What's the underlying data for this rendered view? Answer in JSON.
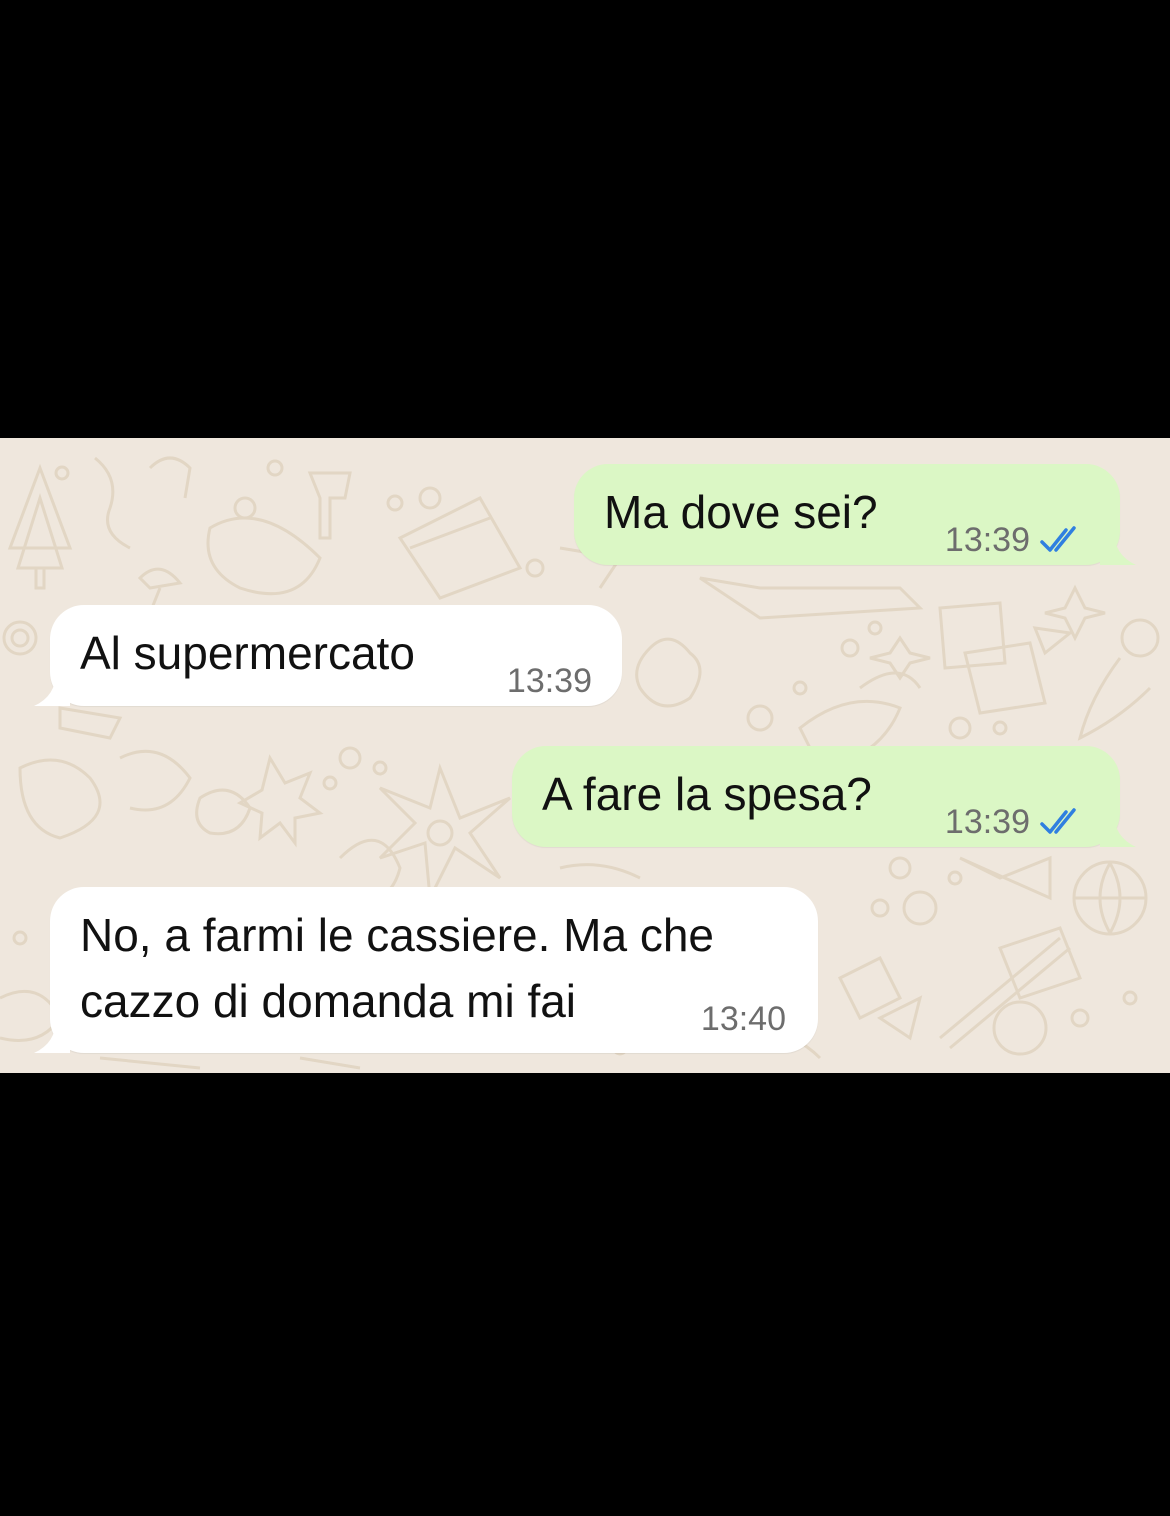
{
  "chat": {
    "messages": [
      {
        "direction": "outgoing",
        "text": "Ma dove sei?",
        "time": "13:39",
        "status": "read"
      },
      {
        "direction": "incoming",
        "text": "Al supermercato",
        "time": "13:39"
      },
      {
        "direction": "outgoing",
        "text": "A fare la spesa?",
        "time": "13:39",
        "status": "read"
      },
      {
        "direction": "incoming",
        "text": "No, a farmi le cassiere. Ma che\ncazzo di domanda mi fai",
        "time": "13:40"
      }
    ]
  },
  "colors": {
    "outgoing_bubble": "#dbf7c5",
    "incoming_bubble": "#ffffff",
    "wallpaper": "#efe7dd",
    "read_receipt": "#2f7fe0",
    "letterbox": "#000000"
  },
  "icons": {
    "read_receipt": "double-check-icon"
  }
}
